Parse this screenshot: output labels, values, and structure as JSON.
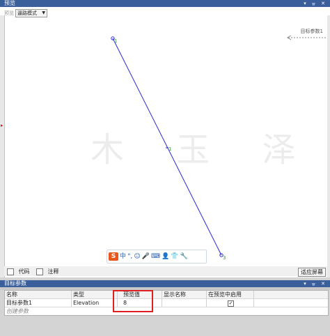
{
  "preview_panel": {
    "title": "预览",
    "title_buttons": "▾ ᚂ ✕",
    "ghost_label": "预览",
    "mode_select": "逼路模式",
    "target_param_label": "目标参数1",
    "watermark": "木 玉 泽",
    "point_labels": {
      "p1": "1",
      "mid": "1",
      "p3": "3"
    },
    "ime_items": [
      "S",
      "中",
      "°,",
      "☺",
      "🎤",
      "⌨",
      "👤",
      "👕",
      "🔧"
    ],
    "code_label": "代码",
    "comment_label": "注释",
    "fit_button": "适应屏幕"
  },
  "params_panel": {
    "title": "目标参数",
    "title_buttons": "▾ ᚂ ✕",
    "columns": [
      "名称",
      "类型",
      "预览值",
      "显示名称",
      "在预览中启用"
    ],
    "rows": [
      {
        "name": "目标参数1",
        "type": "Elevation",
        "value": "8",
        "display": "",
        "enabled": "✓"
      }
    ],
    "new_row": "创建参数"
  },
  "colors": {
    "line": "#2a2adc",
    "point": "#3a9a3a",
    "highlight": "#e02020",
    "titlebar": "#3a5f9a"
  }
}
